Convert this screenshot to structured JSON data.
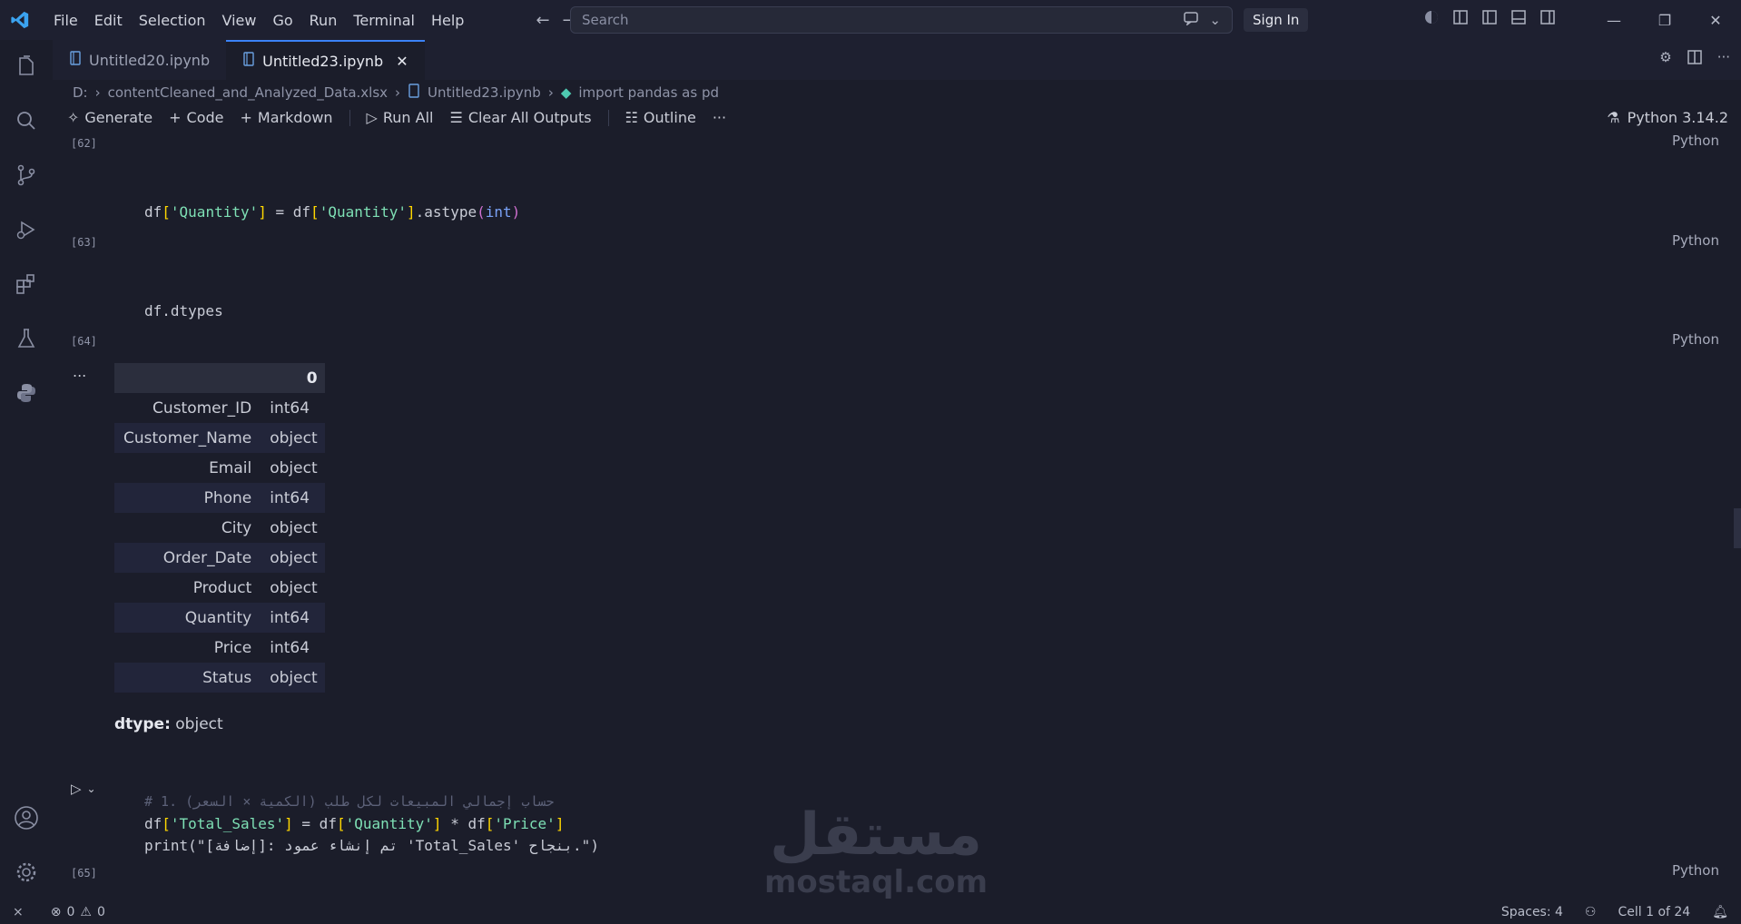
{
  "menu": [
    "File",
    "Edit",
    "Selection",
    "View",
    "Go",
    "Run",
    "Terminal",
    "Help"
  ],
  "search": {
    "placeholder": "Search"
  },
  "sign_in": "Sign In",
  "tabs": [
    {
      "label": "Untitled20.ipynb"
    },
    {
      "label": "Untitled23.ipynb"
    }
  ],
  "breadcrumb": {
    "drive": "D:",
    "file": "contentCleaned_and_Analyzed_Data.xlsx",
    "notebook": "Untitled23.ipynb",
    "cell": "import pandas as pd"
  },
  "toolbar": {
    "generate": "Generate",
    "code": "Code",
    "markdown": "Markdown",
    "run_all": "Run All",
    "clear": "Clear All Outputs",
    "outline": "Outline",
    "more": "···"
  },
  "kernel": "Python 3.14.2",
  "cells": [
    {
      "exec": "[62]",
      "lang": "Python"
    },
    {
      "exec": "[63]",
      "lang": "Python"
    },
    {
      "exec": "[64]",
      "lang": "Python"
    },
    {
      "exec": "[65]",
      "lang": "Python"
    }
  ],
  "code": {
    "line1": "df['Quantity'] = df['Quantity'].astype(int)",
    "line2": "df.dtypes",
    "comment": "# 1. حساب إجمالي المبيعات لكل طلب (الكمية × السعر)",
    "total_sales": "df['Total_Sales'] = df['Quantity'] * df['Price']",
    "print": "print(\"[إضافة]: تم إنشاء عمود 'Total_Sales' بنجاح.\")"
  },
  "output": {
    "ellipsis": "...",
    "header": "0",
    "rows": [
      {
        "name": "Customer_ID",
        "type": "int64"
      },
      {
        "name": "Customer_Name",
        "type": "object"
      },
      {
        "name": "Email",
        "type": "object"
      },
      {
        "name": "Phone",
        "type": "int64"
      },
      {
        "name": "City",
        "type": "object"
      },
      {
        "name": "Order_Date",
        "type": "object"
      },
      {
        "name": "Product",
        "type": "object"
      },
      {
        "name": "Quantity",
        "type": "int64"
      },
      {
        "name": "Price",
        "type": "int64"
      },
      {
        "name": "Status",
        "type": "object"
      }
    ],
    "dtype_label": "dtype:",
    "dtype_value": "object"
  },
  "watermark": {
    "arabic": "مستقل",
    "latin": "mostaql.com"
  },
  "status": {
    "errors": "0",
    "warnings": "0",
    "spaces": "Spaces: 4",
    "cell": "Cell 1 of 24"
  },
  "colors": {
    "accent": "#3b82f6",
    "string": "#7ee0b5",
    "bracket": "#ffd700",
    "background": "#1b1d2a"
  }
}
